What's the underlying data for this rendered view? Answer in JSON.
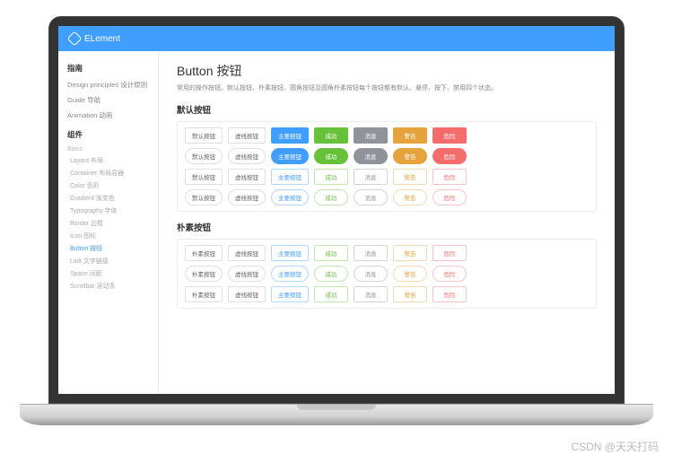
{
  "brand": "ELement",
  "watermark": "CSDN @天天打码",
  "sidebar": {
    "sec1": "指南",
    "guide": [
      "Design principles 设计原则",
      "Guide 导航",
      "Animation 动画"
    ],
    "sec2": "组件",
    "cat_basic": "Basic",
    "basic": [
      "Layout 布局",
      "Container 布局容器",
      "Color 色彩",
      "Gradient 渐变色",
      "Typography 字体",
      "Border 边框",
      "Icon 图标",
      "Button 按钮",
      "Link 文字链接",
      "Space 间距",
      "Scrollbar 滚动条"
    ],
    "active_index": 7
  },
  "page": {
    "title": "Button 按钮",
    "desc": "常用的操作按钮。默认按钮、朴素按钮、圆角按钮及圆角朴素按钮每个按钮都有默认、悬停、按下、禁用四个状态。",
    "section_default": "默认按钮",
    "section_plain": "朴素按钮"
  },
  "btn": {
    "default": "默认按钮",
    "dashed": "虚线按钮",
    "primary": "主要按钮",
    "success": "成功",
    "info": "消息",
    "warning": "警告",
    "danger": "危险",
    "plain": "朴素按钮"
  }
}
